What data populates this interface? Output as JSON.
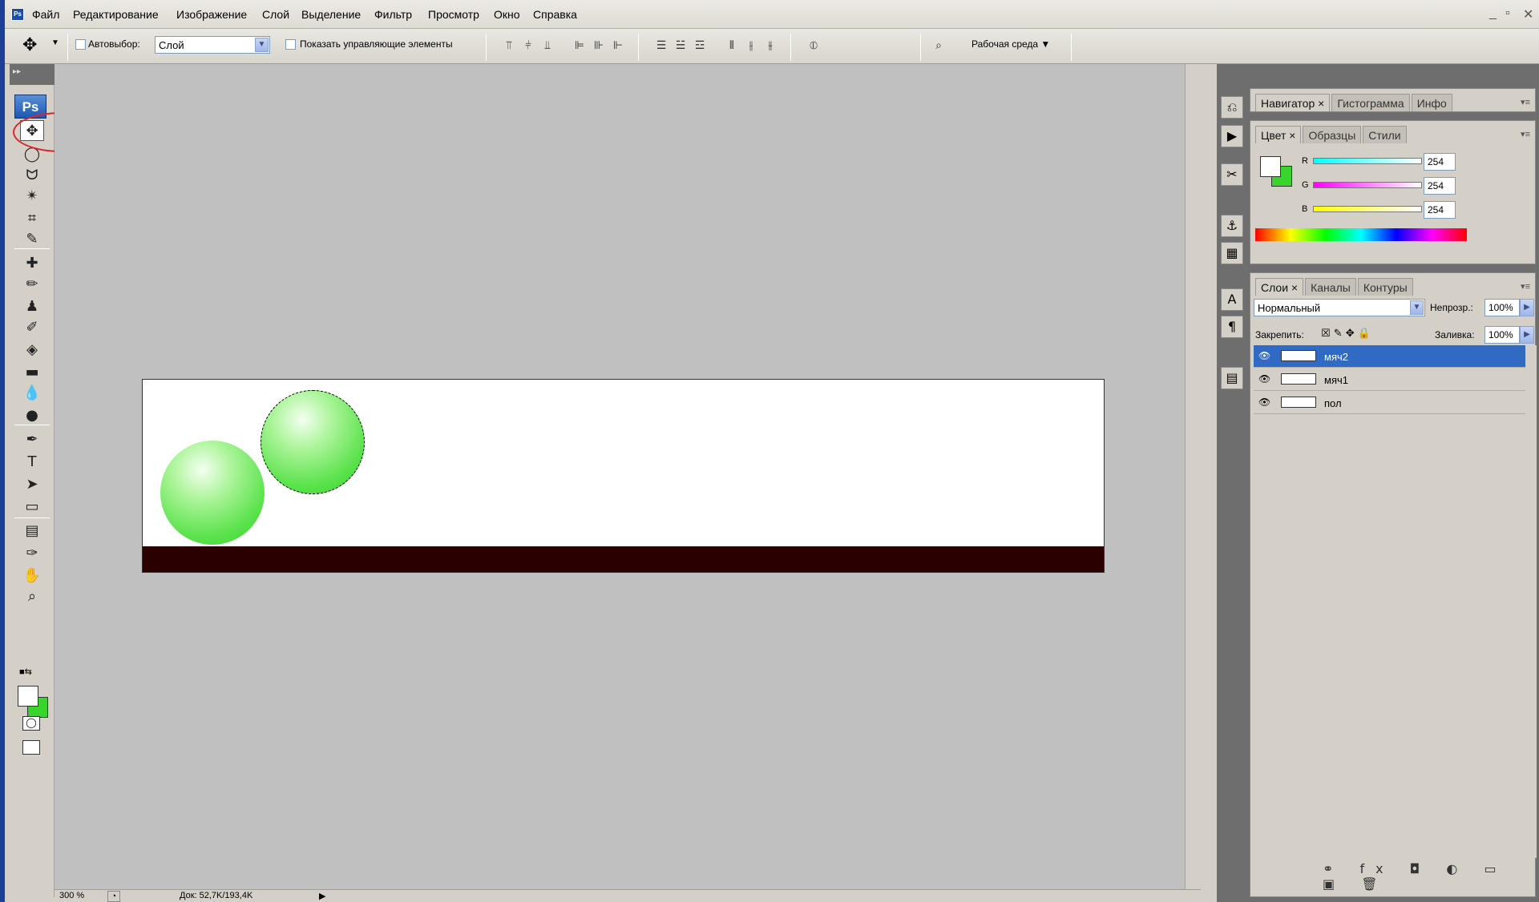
{
  "menubar": {
    "items": [
      "Файл",
      "Редактирование",
      "Изображение",
      "Слой",
      "Выделение",
      "Фильтр",
      "Просмотр",
      "Окно",
      "Справка"
    ],
    "window_controls": [
      "_",
      "▫",
      "✕"
    ]
  },
  "options": {
    "move_icon": "move-tool-icon",
    "autoselect_label": "Автовыбор:",
    "autoselect_value": "Слой",
    "show_controls_label": "Показать управляющие элементы",
    "workspace_label": "Рабочая среда ▼"
  },
  "toolbox": {
    "collapse": "▸▸",
    "ps": "Ps",
    "tools": [
      {
        "name": "move-tool-icon",
        "glyph": "✥"
      },
      {
        "name": "marquee-tool-icon",
        "glyph": "◯"
      },
      {
        "name": "lasso-tool-icon",
        "glyph": "ᗢ"
      },
      {
        "name": "magic-wand-tool-icon",
        "glyph": "✴"
      },
      {
        "name": "crop-tool-icon",
        "glyph": "⌗"
      },
      {
        "name": "slice-tool-icon",
        "glyph": "✎"
      },
      {
        "name": "healing-brush-tool-icon",
        "glyph": "✚"
      },
      {
        "name": "brush-tool-icon",
        "glyph": "✏"
      },
      {
        "name": "stamp-tool-icon",
        "glyph": "♟"
      },
      {
        "name": "history-brush-tool-icon",
        "glyph": "✐"
      },
      {
        "name": "eraser-tool-icon",
        "glyph": "◈"
      },
      {
        "name": "gradient-tool-icon",
        "glyph": "▬"
      },
      {
        "name": "blur-tool-icon",
        "glyph": "💧"
      },
      {
        "name": "dodge-tool-icon",
        "glyph": "●"
      },
      {
        "name": "pen-tool-icon",
        "glyph": "✒"
      },
      {
        "name": "type-tool-icon",
        "glyph": "T"
      },
      {
        "name": "path-selection-tool-icon",
        "glyph": "➤"
      },
      {
        "name": "shape-tool-icon",
        "glyph": "▭"
      },
      {
        "name": "notes-tool-icon",
        "glyph": "▤"
      },
      {
        "name": "eyedropper-tool-icon",
        "glyph": "✑"
      },
      {
        "name": "hand-tool-icon",
        "glyph": "✋"
      },
      {
        "name": "zoom-tool-icon",
        "glyph": "⌕"
      }
    ],
    "fg_color": "#ffffff",
    "bg_color": "#39d42c"
  },
  "status": {
    "zoom": "300 %",
    "doc": "Док: 52,7K/193,4K",
    "arrow": "▶"
  },
  "navigator_panel": {
    "tabs": [
      "Навигатор ×",
      "Гистограмма",
      "Инфо"
    ]
  },
  "color_panel": {
    "tabs": [
      "Цвет ×",
      "Образцы",
      "Стили"
    ],
    "channels": [
      {
        "label": "R",
        "value": "254"
      },
      {
        "label": "G",
        "value": "254"
      },
      {
        "label": "B",
        "value": "254"
      }
    ],
    "fg_color": "#ffffff",
    "bg_color": "#39d42c"
  },
  "layers_panel": {
    "tabs": [
      "Слои ×",
      "Каналы",
      "Контуры"
    ],
    "blend_mode": "Нормальный",
    "opacity_label": "Непрозр.:",
    "opacity": "100%",
    "lock_label": "Закрепить:",
    "fill_label": "Заливка:",
    "fill": "100%",
    "layers": [
      {
        "name": "мяч2",
        "selected": true
      },
      {
        "name": "мяч1",
        "selected": false
      },
      {
        "name": "пол",
        "selected": false
      }
    ],
    "footer_icons": "⚭ fx ◘ ◐ ▭ ▣ 🗑"
  }
}
